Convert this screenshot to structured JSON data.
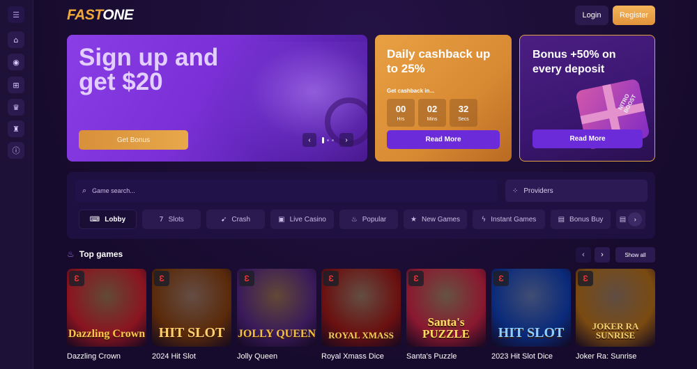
{
  "sidebar": {
    "items": [
      {
        "icon": "menu-icon",
        "glyph": "☰"
      },
      {
        "icon": "home-icon",
        "glyph": "⌂"
      },
      {
        "icon": "chips-icon",
        "glyph": "◉"
      },
      {
        "icon": "gift-icon",
        "glyph": "⊞"
      },
      {
        "icon": "crown-icon",
        "glyph": "♛"
      },
      {
        "icon": "trophy-icon",
        "glyph": "♜"
      },
      {
        "icon": "info-icon",
        "glyph": "ⓘ"
      }
    ]
  },
  "header": {
    "logo_part1": "FAST",
    "logo_part2": "ONE",
    "login_label": "Login",
    "register_label": "Register"
  },
  "hero": {
    "title": "Sign up and get $20",
    "button_label": "Get Bonus",
    "prev_glyph": "‹",
    "next_glyph": "›"
  },
  "cashback": {
    "title": "Daily cashback up to 25%",
    "countdown_label": "Get cashback in...",
    "timer": [
      {
        "value": "00",
        "unit": "Hrs"
      },
      {
        "value": "02",
        "unit": "Mins"
      },
      {
        "value": "32",
        "unit": "Secs"
      }
    ],
    "button_label": "Read More"
  },
  "bonus": {
    "title": "Bonus +50% on every deposit",
    "gift_text": "NITRO BOOST",
    "button_label": "Read More"
  },
  "search": {
    "placeholder": "Game search...",
    "providers_label": "Providers"
  },
  "tabs": [
    {
      "label": "Lobby",
      "icon": "gamepad-icon",
      "glyph": "⌨",
      "active": true
    },
    {
      "label": "Slots",
      "icon": "slots-icon",
      "glyph": "7"
    },
    {
      "label": "Crash",
      "icon": "rocket-icon",
      "glyph": "➹"
    },
    {
      "label": "Live Casino",
      "icon": "live-icon",
      "glyph": "▣"
    },
    {
      "label": "Popular",
      "icon": "flame-icon",
      "glyph": "♨"
    },
    {
      "label": "New Games",
      "icon": "star-icon",
      "glyph": "★"
    },
    {
      "label": "Instant Games",
      "icon": "bolt-icon",
      "glyph": "ϟ"
    },
    {
      "label": "Bonus Buy",
      "icon": "bonus-buy-icon",
      "glyph": "▤"
    }
  ],
  "top_games": {
    "title": "Top games",
    "show_all_label": "Show all",
    "prev_glyph": "‹",
    "next_glyph": "›",
    "games": [
      {
        "name": "Dazzling Crown",
        "art": "Dazzling Crown",
        "bg": "#8a1420",
        "fg": "#f7c84a"
      },
      {
        "name": "2024 Hit Slot",
        "art": "HIT SLOT",
        "bg": "#5a2a0a",
        "fg": "#ffd070"
      },
      {
        "name": "Jolly Queen",
        "art": "JOLLY QUEEN",
        "bg": "#3a1a5a",
        "fg": "#f4c040"
      },
      {
        "name": "Royal Xmass Dice",
        "art": "ROYAL XMASS",
        "bg": "#6a1010",
        "fg": "#f8d060"
      },
      {
        "name": "Santa's Puzzle",
        "art": "Santa's PUZZLE",
        "bg": "#8a1830",
        "fg": "#ffe060"
      },
      {
        "name": "2023 Hit Slot Dice",
        "art": "HIT SLOT",
        "bg": "#0a2a7a",
        "fg": "#8fd0ff"
      },
      {
        "name": "Joker Ra: Sunrise",
        "art": "JOKER RA SUNRISE",
        "bg": "#7a4a10",
        "fg": "#f0d070"
      }
    ]
  }
}
